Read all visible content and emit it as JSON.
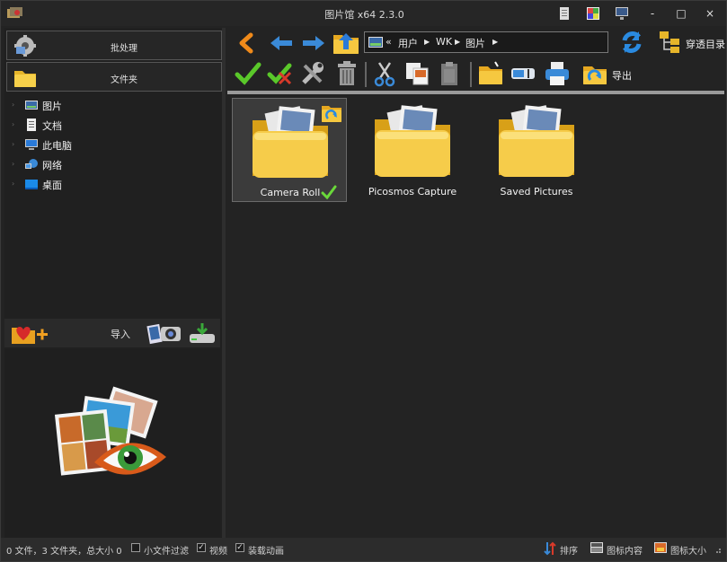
{
  "app": {
    "title": "图片馆 x64 2.3.0"
  },
  "window_controls": {
    "minimize": "-",
    "maximize": "□",
    "close": "×"
  },
  "left_panel": {
    "batch_label": "批处理",
    "folder_label": "文件夹",
    "tree": [
      {
        "label": "图片",
        "icon": "pictures-icon"
      },
      {
        "label": "文档",
        "icon": "documents-icon"
      },
      {
        "label": "此电脑",
        "icon": "computer-icon"
      },
      {
        "label": "网络",
        "icon": "network-icon"
      },
      {
        "label": "桌面",
        "icon": "desktop-icon"
      }
    ],
    "import_label": "导入"
  },
  "address_bar": {
    "prefix": "«",
    "parts": [
      "用户",
      "WK",
      "图片"
    ]
  },
  "nav": {
    "passthrough_label": "穿透目录"
  },
  "toolbar": {
    "export_label": "导出"
  },
  "files": [
    {
      "name": "Camera Roll",
      "selected": true
    },
    {
      "name": "Picosmos Capture",
      "selected": false
    },
    {
      "name": "Saved Pictures",
      "selected": false
    }
  ],
  "status": {
    "summary": "0 文件，3 文件夹，总大小 0",
    "small_filter_label": "小文件过滤",
    "video_label": "视频",
    "animation_label": "装载动画",
    "sort_label": "排序",
    "icon_content_label": "图标内容",
    "icon_size_label": "图标大小"
  }
}
